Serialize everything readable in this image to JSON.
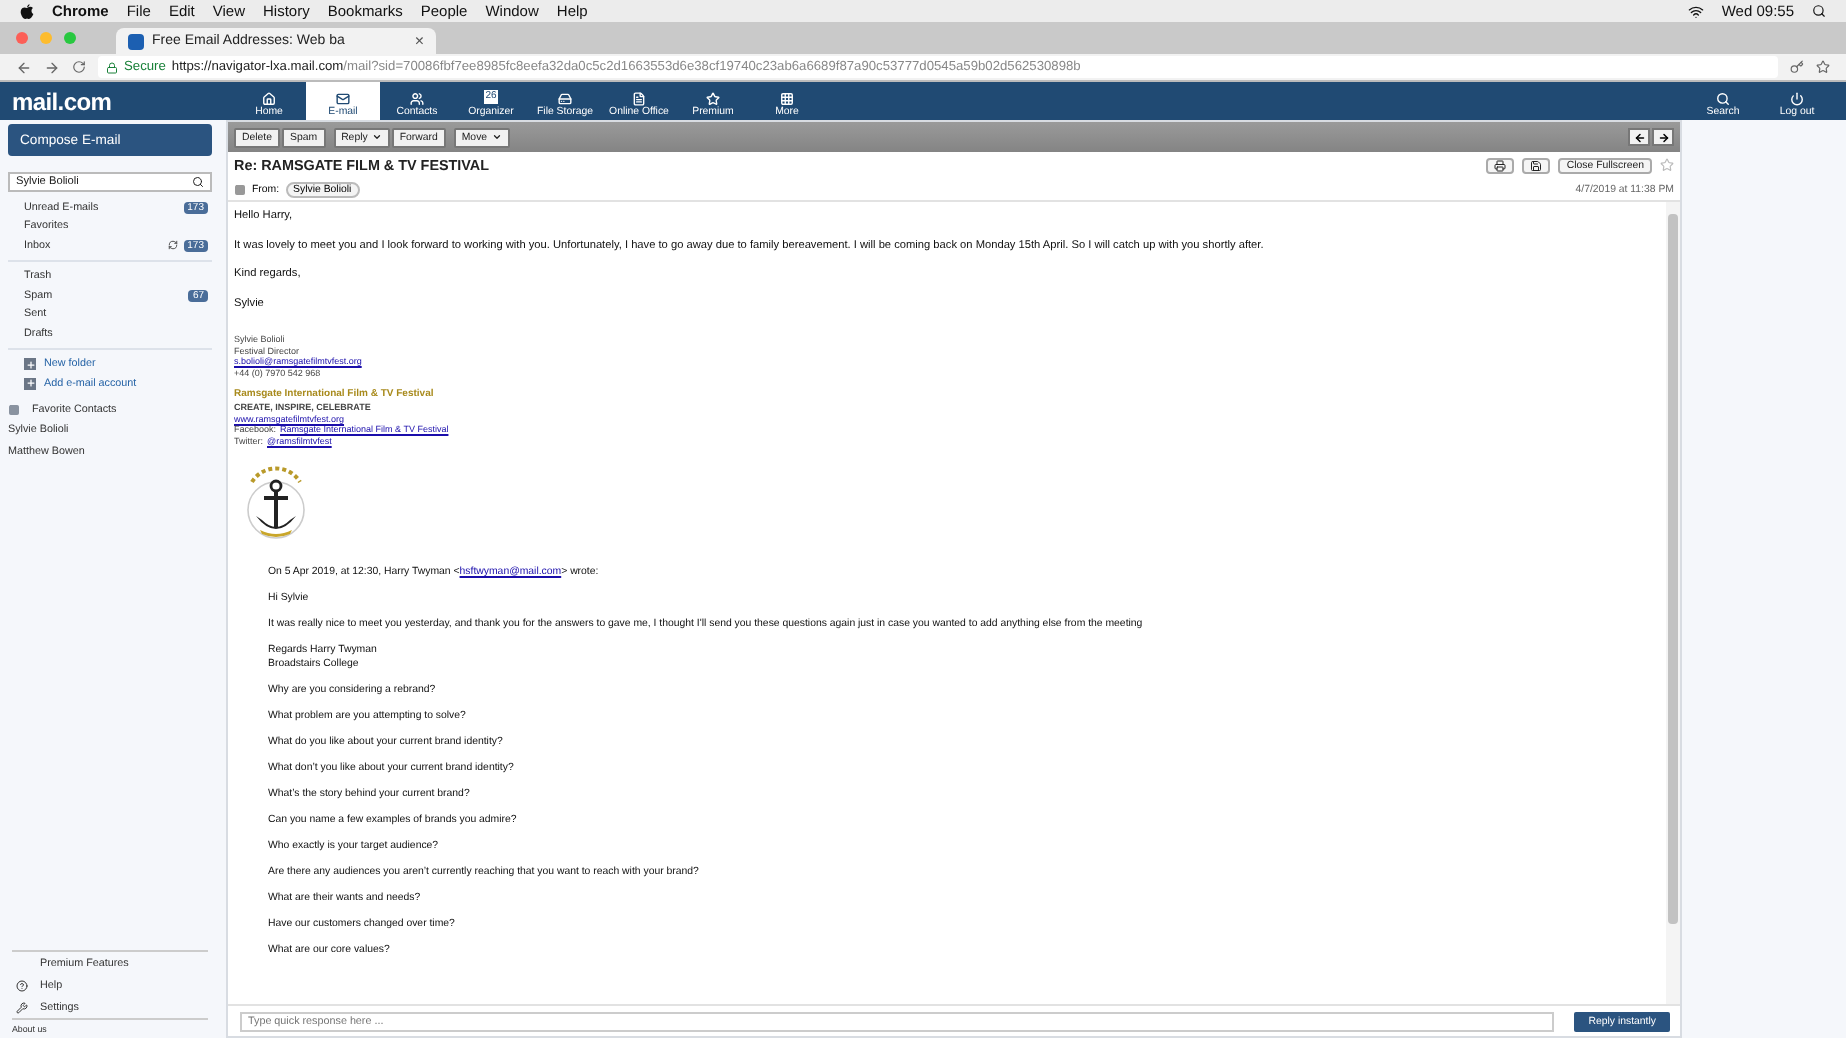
{
  "menubar": {
    "app": "Chrome",
    "items": [
      "File",
      "Edit",
      "View",
      "History",
      "Bookmarks",
      "People",
      "Window",
      "Help"
    ],
    "clock": "Wed 09:55"
  },
  "browser_tab": {
    "title": "Free Email Addresses: Web ba",
    "close": "×"
  },
  "address_bar": {
    "secure_label": "Secure",
    "url_host": "https://navigator-lxa.mail.com",
    "url_path": "/mail?sid=70086fbf7ee8985fc8eefa32da0c5c2d1663553d6e38cf19740c23ab6a6689f87a90c53777d0545a59b02d562530898b"
  },
  "site": {
    "logo": "mail.com",
    "nav": [
      {
        "label": "Home",
        "selected": false
      },
      {
        "label": "E-mail",
        "selected": true
      },
      {
        "label": "Contacts",
        "selected": false
      },
      {
        "label": "Organizer",
        "badge": "26",
        "selected": false
      },
      {
        "label": "File Storage",
        "selected": false
      },
      {
        "label": "Online Office",
        "selected": false
      },
      {
        "label": "Premium",
        "selected": false
      },
      {
        "label": "More",
        "selected": false
      }
    ],
    "right": [
      {
        "label": "Search"
      },
      {
        "label": "Log out"
      }
    ]
  },
  "sidebar": {
    "compose": "Compose E-mail",
    "search_value": "Sylvie Bolioli",
    "folder_groups": [
      [
        {
          "label": "Unread E-mails",
          "count": "173",
          "sync": false
        },
        {
          "label": "Favorites",
          "sync": false
        },
        {
          "label": "Inbox",
          "count": "173",
          "sync": true
        }
      ],
      [
        {
          "label": "Trash",
          "sync": false
        },
        {
          "label": "Spam",
          "count": "67",
          "sync": false
        },
        {
          "label": "Sent",
          "sync": false
        },
        {
          "label": "Drafts",
          "sync": false
        }
      ]
    ],
    "actions": [
      "New folder",
      "Add e-mail account"
    ],
    "contacts_heading": "Favorite Contacts",
    "contacts": [
      "Sylvie Bolioli",
      "Matthew Bowen"
    ],
    "footer": [
      "Premium Features",
      "Help",
      "Settings"
    ],
    "about": "About us"
  },
  "toolbar": {
    "groups": [
      [
        {
          "label": "Delete",
          "dropdown": false
        },
        {
          "label": "Spam",
          "dropdown": false
        }
      ],
      [
        {
          "label": "Reply",
          "dropdown": true
        },
        {
          "label": "Forward",
          "dropdown": false
        }
      ],
      [
        {
          "label": "Move",
          "dropdown": true
        }
      ]
    ]
  },
  "message": {
    "subject": "Re: RAMSGATE FILM & TV FESTIVAL",
    "close_button": "Close Fullscreen",
    "starred": false,
    "from_label": "From:",
    "sender": "Sylvie Bolioli",
    "date": "4/7/2019 at 11:38 PM",
    "paragraphs": [
      "Hello Harry,",
      "It was lovely to meet you and I look forward to working with you. Unfortunately, I have to go away due to family bereavement. I will be coming back on Monday 15th April. So I will catch up with you shortly after.",
      "Kind regards,",
      "Sylvie"
    ],
    "signature": [
      [
        {
          "kind": "plain",
          "text": "Sylvie Bolioli"
        },
        {
          "kind": "plain",
          "text": "Festival Director"
        },
        {
          "kind": "link",
          "text": "s.bolioli@ramsgatefilmtvfest.org"
        },
        {
          "kind": "plain",
          "text": "+44 (0) 7970 542 968"
        }
      ],
      [
        {
          "kind": "title",
          "text": "Ramsgate International Film & TV Festival"
        },
        {
          "kind": "tagline",
          "text": "CREATE, INSPIRE, CELEBRATE"
        },
        {
          "kind": "link",
          "text": "www.ramsgatefilmtvfest.org"
        },
        {
          "kind": "labeled",
          "label": "Facebook:",
          "text": "Ramsgate International Film & TV Festival"
        },
        {
          "kind": "labeled",
          "label": "Twitter:",
          "text": "@ramsfilmtvfest"
        }
      ]
    ],
    "quote": {
      "header": {
        "before": "On 5 Apr 2019, at 12:30, Harry Twyman <",
        "link": "hsftwyman@mail.com",
        "after": "> wrote:"
      },
      "paragraphs": [
        [
          "Hi Sylvie"
        ],
        [
          "It was really nice to meet you yesterday, and thank you for the answers to gave me, I thought I'll send you these questions again just in case you wanted to add anything else from the meeting"
        ],
        [
          "Regards Harry Twyman",
          "Broadstairs College"
        ],
        [
          "Why are you considering a rebrand?"
        ],
        [
          "What problem are you attempting to solve?"
        ],
        [
          "What do you like about your current brand identity?"
        ],
        [
          "What don’t you like about your current brand identity?"
        ],
        [
          "What’s the story behind your current brand?"
        ],
        [
          "Can you name a few examples of brands you admire?"
        ],
        [
          "Who exactly is your target audience?"
        ],
        [
          "Are there any audiences you aren’t currently reaching that you want to reach with your brand?"
        ],
        [
          "What are their wants and needs?"
        ],
        [
          "Have our customers changed over time?"
        ],
        [
          "What are our core values?"
        ]
      ]
    }
  },
  "quick_reply": {
    "placeholder": "Type quick response here ...",
    "button": "Reply instantly"
  }
}
